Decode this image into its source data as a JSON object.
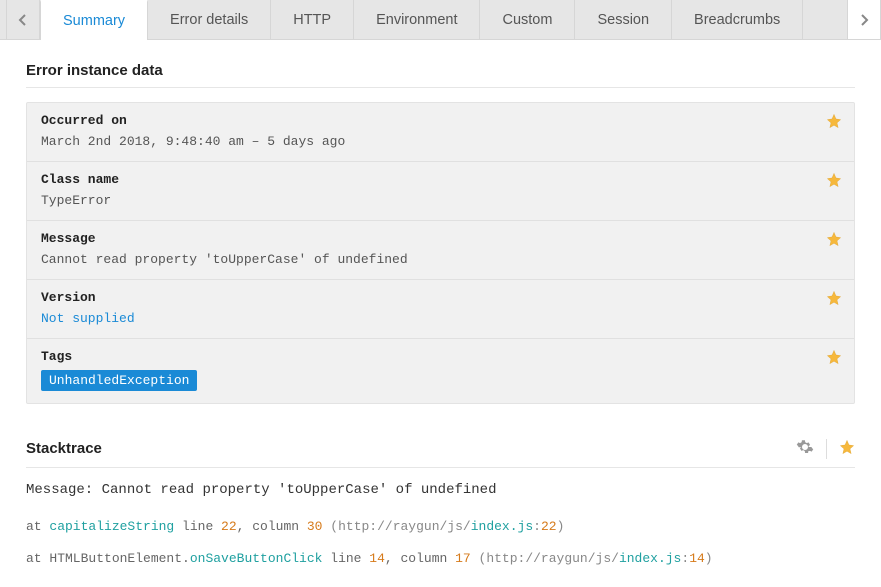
{
  "tabs": [
    {
      "label": "Summary",
      "active": true
    },
    {
      "label": "Error details",
      "active": false
    },
    {
      "label": "HTTP",
      "active": false
    },
    {
      "label": "Environment",
      "active": false
    },
    {
      "label": "Custom",
      "active": false
    },
    {
      "label": "Session",
      "active": false
    },
    {
      "label": "Breadcrumbs",
      "active": false
    }
  ],
  "section_title": "Error instance data",
  "rows": {
    "occurred_on": {
      "label": "Occurred on",
      "value": "March 2nd 2018, 9:48:40 am – 5 days ago"
    },
    "class_name": {
      "label": "Class name",
      "value": "TypeError"
    },
    "message": {
      "label": "Message",
      "value": "Cannot read property 'toUpperCase' of undefined"
    },
    "version": {
      "label": "Version",
      "value": "Not supplied"
    },
    "tags": {
      "label": "Tags",
      "items": [
        "UnhandledException"
      ]
    }
  },
  "stacktrace": {
    "title": "Stacktrace",
    "message_prefix": "Message: ",
    "message_body": "Cannot read property 'toUpperCase' of undefined",
    "frames": [
      {
        "at": "at ",
        "func": "capitalizeString",
        "mid1": " line ",
        "line": "22",
        "mid2": ", column ",
        "col": "30",
        "open": " (http://raygun/js/",
        "file": "index.js",
        "colon": ":",
        "fline": "22",
        "close": ")"
      },
      {
        "at": "at ",
        "pre": "HTMLButtonElement.",
        "func": "onSaveButtonClick",
        "mid1": " line ",
        "line": "14",
        "mid2": ", column ",
        "col": "17",
        "open": " (http://raygun/js/",
        "file": "index.js",
        "colon": ":",
        "fline": "14",
        "close": ")"
      }
    ]
  }
}
